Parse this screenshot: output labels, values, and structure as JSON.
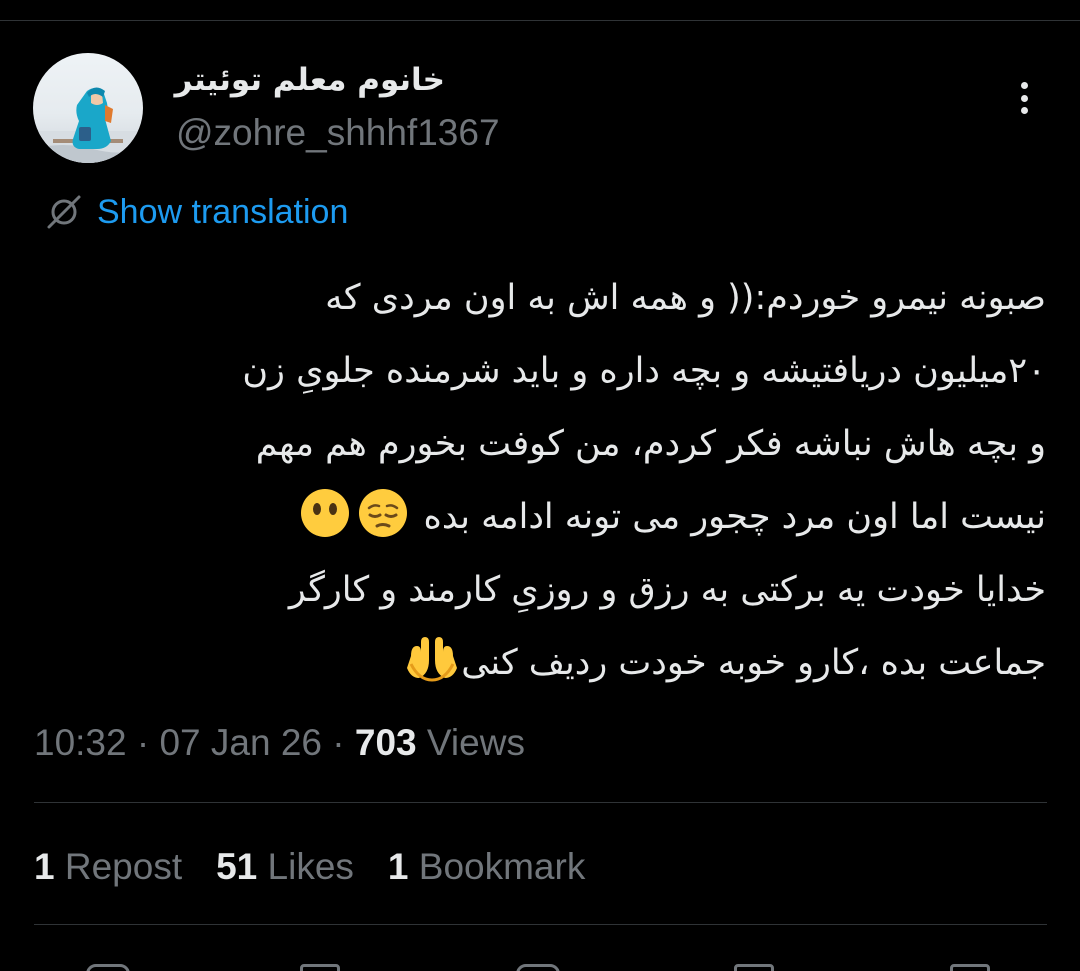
{
  "author": {
    "display_name": "خانوم معلم توئیتر",
    "handle": "@zohre_shhhf1367"
  },
  "translate": {
    "label": "Show translation",
    "icon": "globe-slash-icon"
  },
  "tweet": {
    "lines": [
      "صبونه نیمرو خوردم:(( و همه اش  به اون مردی که",
      "۲۰میلیون دریافتیشه و بچه داره و باید شرمنده جلویِ زن",
      "و بچه هاش نباشه فکر کردم، من کوفت بخورم هم مهم",
      "نیست اما اون مرد چجور می تونه ادامه بده",
      "خدایا خودت یه برکتی به رزق و روزیِ کارمند و کارگر",
      "جماعت بده ،کارو خوبه خودت ردیف کنی"
    ],
    "emoji": {
      "line4": [
        "pensive-face-emoji",
        "face-without-mouth-emoji"
      ],
      "line6": [
        "palms-up-together-emoji"
      ]
    }
  },
  "meta": {
    "time": "10:32",
    "separator": " · ",
    "date": "07 Jan 26",
    "views_count": "703",
    "views_label": " Views"
  },
  "stats": {
    "reposts": {
      "count": "1",
      "label": "Repost"
    },
    "likes": {
      "count": "51",
      "label": "Likes"
    },
    "bookmarks": {
      "count": "1",
      "label": "Bookmark"
    }
  },
  "colors": {
    "background": "#000000",
    "text": "#e7e9ea",
    "secondary": "#71767b",
    "link": "#1d9bf0",
    "divider": "#2f3336"
  }
}
